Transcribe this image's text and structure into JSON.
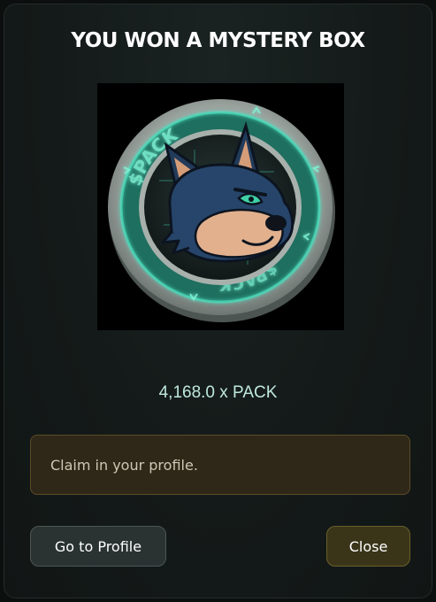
{
  "dialog": {
    "title": "YOU WON A MYSTERY BOX",
    "reward": {
      "amount_text": "4,168.0 x PACK",
      "image": {
        "icon": "pack-coin-wolf-icon",
        "coin_text": "$PACK"
      }
    },
    "notice": "Claim in your profile.",
    "buttons": {
      "profile": "Go to Profile",
      "close": "Close"
    }
  },
  "colors": {
    "accent_teal": "#2fb89a",
    "notice_bg": "#2f2819",
    "close_bg": "#3a3519"
  }
}
